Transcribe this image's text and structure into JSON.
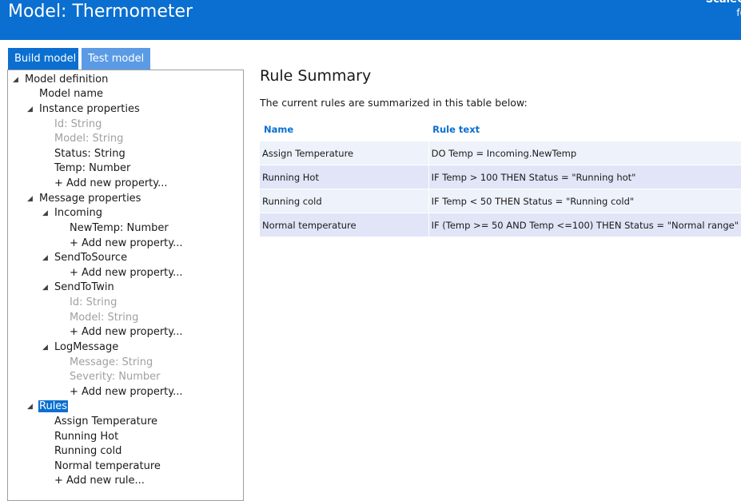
{
  "header": {
    "title": "Model: Thermometer",
    "brand_line1": "ScaleO",
    "brand_line2": "fo"
  },
  "tabs": [
    {
      "label": "Build model"
    },
    {
      "label": "Test model"
    }
  ],
  "tree": {
    "model_definition": "Model definition",
    "model_name": "Model name",
    "instance_properties": "Instance properties",
    "instance_items": [
      "Id: String",
      "Model: String",
      "Status: String",
      "Temp: Number"
    ],
    "add_property": "+ Add new property...",
    "message_properties": "Message properties",
    "incoming": "Incoming",
    "incoming_items": [
      "NewTemp: Number"
    ],
    "send_to_source": "SendToSource",
    "send_to_twin": "SendToTwin",
    "send_to_twin_items": [
      "Id: String",
      "Model: String"
    ],
    "log_message": "LogMessage",
    "log_message_items": [
      "Message: String",
      "Severity: Number"
    ],
    "rules": "Rules",
    "rule_items": [
      "Assign Temperature",
      "Running Hot",
      "Running cold",
      "Normal temperature"
    ],
    "add_rule": "+ Add new rule..."
  },
  "summary": {
    "title": "Rule Summary",
    "description": "The current rules are summarized in this table below:",
    "columns": [
      "Name",
      "Rule text"
    ],
    "rows": [
      {
        "name": "Assign Temperature",
        "text": "DO Temp = Incoming.NewTemp"
      },
      {
        "name": "Running Hot",
        "text": "IF Temp > 100 THEN Status = \"Running hot\""
      },
      {
        "name": "Running cold",
        "text": "IF Temp < 50 THEN Status = \"Running cold\""
      },
      {
        "name": "Normal temperature",
        "text": "IF (Temp >= 50 AND Temp <=100) THEN Status = \"Normal range\""
      }
    ]
  },
  "colors": {
    "accent": "#0a6fd0",
    "tab_inactive": "#5b9be6",
    "row_light": "#eef2fa",
    "row_dark": "#e1e5f7"
  }
}
